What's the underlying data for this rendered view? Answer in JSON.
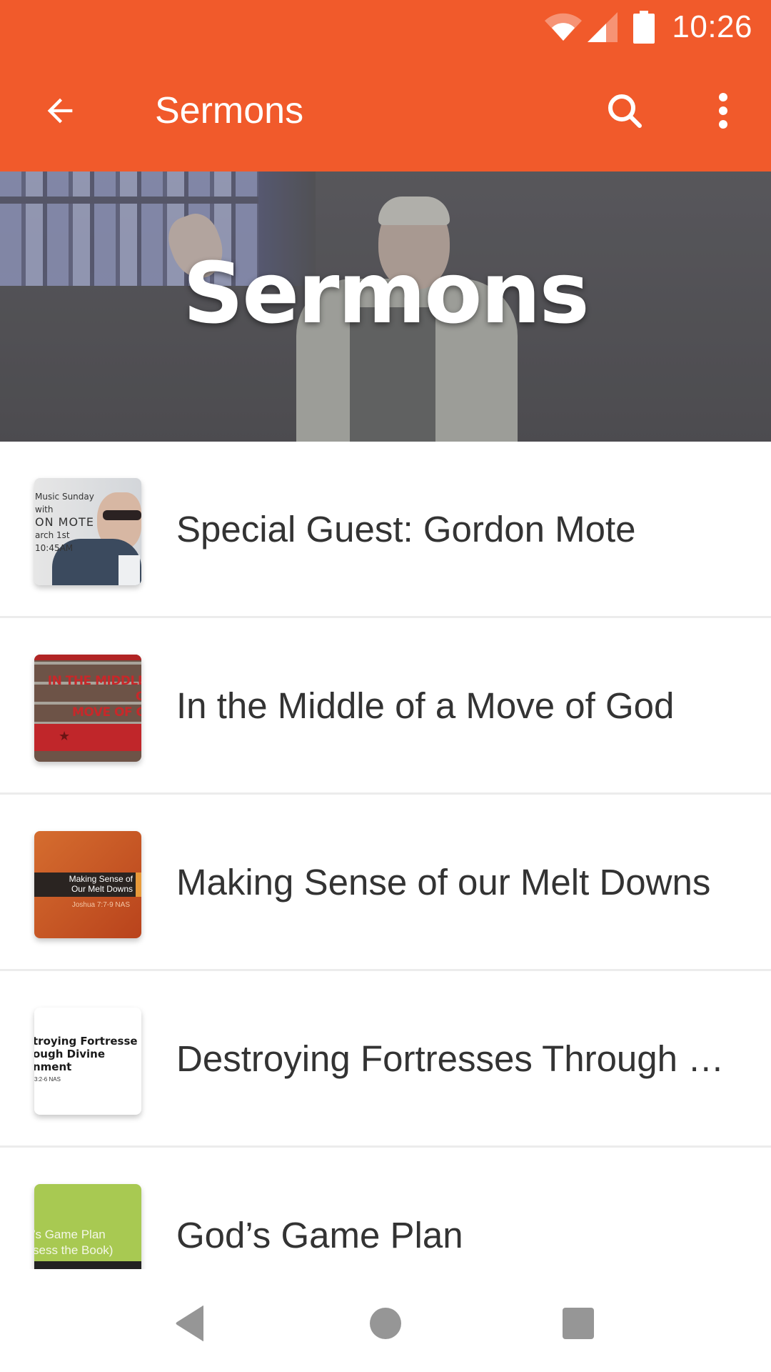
{
  "status_bar": {
    "time": "10:26",
    "icons": [
      "wifi-icon",
      "cell-signal-icon",
      "battery-icon"
    ]
  },
  "toolbar": {
    "title": "Sermons",
    "back_icon": "arrow-back-icon",
    "search_icon": "search-icon",
    "more_icon": "more-vert-icon"
  },
  "hero": {
    "title": "Sermons"
  },
  "sermons": [
    {
      "title": "Special Guest: Gordon Mote",
      "thumb_lines": [
        "Music Sunday",
        "with",
        "ON MOTE",
        "arch 1st",
        "10:45AM"
      ]
    },
    {
      "title": "In the Middle of a Move of God",
      "thumb_lines": [
        "IN THE MIDDLE O",
        "MOVE OF G"
      ]
    },
    {
      "title": "Making Sense of our Melt Downs",
      "thumb_lines": [
        "Making Sense of",
        "Our Melt Downs",
        "Joshua 7:7-9 NAS"
      ]
    },
    {
      "title": "Destroying Fortresses Through D...",
      "thumb_lines": [
        "troying Fortresse",
        "ough Divine",
        "nment",
        "3:2-6 NAS"
      ]
    },
    {
      "title": "God’s Game Plan",
      "thumb_lines": [
        "’s Game Plan",
        "sess the Book)"
      ]
    }
  ],
  "nav_bar": {
    "back_icon": "nav-back-icon",
    "home_icon": "nav-home-icon",
    "recents_icon": "nav-recents-icon"
  },
  "colors": {
    "accent": "#F15A2B",
    "title_text": "#333333",
    "divider": "#ECECEC",
    "nav_icon": "#969696"
  }
}
